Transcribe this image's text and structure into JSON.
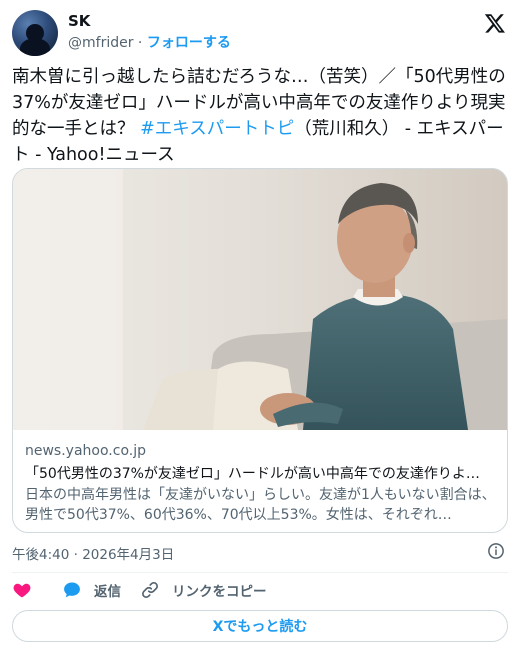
{
  "user": {
    "name": "SK",
    "handle": "@mfrider",
    "separator": "·",
    "follow_label": "フォローする"
  },
  "tweet": {
    "text_before": "南木曽に引っ越したら詰むだろうな…（苦笑）／「50代男性の37%が友達ゼロ」ハードルが高い中高年での友達作りより現実的な一手とは？ ",
    "hashtag": "#エキスパートトピ",
    "text_after": "（荒川和久） - エキスパート - Yahoo!ニュース"
  },
  "card": {
    "domain": "news.yahoo.co.jp",
    "title": "「50代男性の37%が友達ゼロ」ハードルが高い中高年での友達作りよ…",
    "description": "日本の中高年男性は「友達がいない」らしい。友達が1人もいない割合は、男性で50代37%、60代36%、70代以上53%。女性は、それぞれ…"
  },
  "timestamp": "午後4:40 · 2026年4月3日",
  "actions": {
    "like_label": "",
    "reply_label": "返信",
    "copy_link_label": "リンクをコピー"
  },
  "more_label": "Xでもっと読む",
  "colors": {
    "accent": "#1d9bf0",
    "like": "#f91880",
    "text": "#0f1419",
    "muted": "#536471"
  },
  "icons": {
    "brand": "x-logo-icon",
    "info": "info-icon",
    "like": "heart-icon",
    "reply": "speech-bubble-icon",
    "copy_link": "link-icon"
  }
}
